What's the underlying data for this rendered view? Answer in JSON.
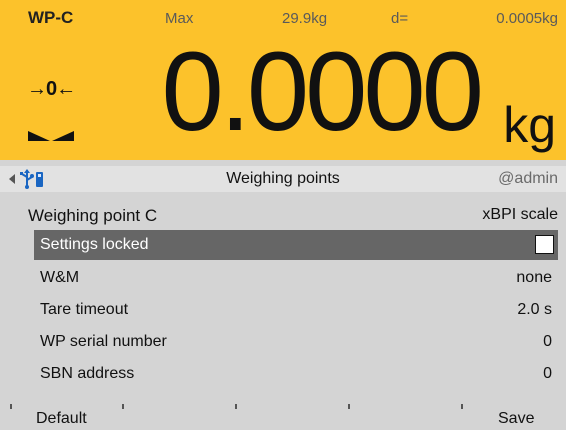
{
  "display": {
    "wp_name": "WP-C",
    "max_label": "Max",
    "max_value": "29.9kg",
    "d_label": "d=",
    "d_value": "0.0005kg",
    "zero_indicator": "→0←",
    "weight": "0.0000",
    "unit": "kg",
    "stable_icon": "stable-triangles-icon"
  },
  "titlebar": {
    "nav_icon": "arrow-left-icon",
    "connection_icon": "usb-connection-icon",
    "title": "Weighing points",
    "user": "@admin"
  },
  "menu": {
    "header_left": "Weighing point C",
    "header_right": "xBPI scale",
    "rows": [
      {
        "label": "Settings locked",
        "value": "",
        "checked": false,
        "selected": true
      },
      {
        "label": "W&M",
        "value": "none"
      },
      {
        "label": "Tare timeout",
        "value": "2.0 s"
      },
      {
        "label": "WP serial number",
        "value": "0"
      },
      {
        "label": "SBN address",
        "value": "0"
      }
    ]
  },
  "softkeys": {
    "left": "Default",
    "right": "Save"
  },
  "colors": {
    "display_bg": "#fcc22b",
    "selected_row": "#666666",
    "background": "#d4d4d4"
  }
}
